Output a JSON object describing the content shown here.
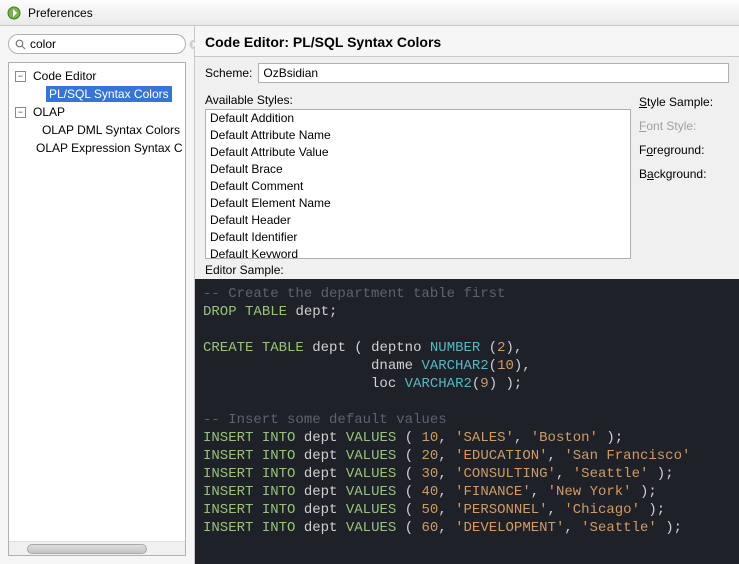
{
  "window": {
    "title": "Preferences"
  },
  "search": {
    "value": "color"
  },
  "tree": {
    "items": [
      {
        "label": "Code Editor"
      },
      {
        "label": "PL/SQL Syntax Colors"
      },
      {
        "label": "OLAP"
      },
      {
        "label": "OLAP DML Syntax Colors"
      },
      {
        "label": "OLAP Expression Syntax C"
      }
    ]
  },
  "panel": {
    "title": "Code Editor: PL/SQL Syntax Colors",
    "scheme_label": "Scheme:",
    "scheme_value": "OzBsidian",
    "available_styles_label": "Available Styles:",
    "styles": [
      "Default Addition",
      "Default Attribute Name",
      "Default Attribute Value",
      "Default Brace",
      "Default Comment",
      "Default Element Name",
      "Default Header",
      "Default Identifier",
      "Default Keyword"
    ],
    "style_sample_label": "Style Sample:",
    "font_style_label": "Font Style:",
    "foreground_label": "Foreground:",
    "background_label": "Background:",
    "editor_sample_label": "Editor Sample:"
  },
  "code": {
    "line1_comment": "-- Create the department table first",
    "drop": "DROP",
    "table": "TABLE",
    "dept": "dept",
    "semi": ";",
    "create": "CREATE",
    "lpar": "(",
    "rpar": ")",
    "deptno": "deptno",
    "number": "NUMBER",
    "num2": "2",
    "dname": "dname",
    "varchar2": "VARCHAR2",
    "num10": "10",
    "loc": "loc",
    "num9": "9",
    "comment2": "-- Insert some default values",
    "insert": "INSERT",
    "into": "INTO",
    "values": "VALUES",
    "rows": [
      {
        "n": "10",
        "a": "'SALES'",
        "b": "'Boston'"
      },
      {
        "n": "20",
        "a": "'EDUCATION'",
        "b": "'San Francisco'"
      },
      {
        "n": "30",
        "a": "'CONSULTING'",
        "b": "'Seattle'"
      },
      {
        "n": "40",
        "a": "'FINANCE'",
        "b": "'New York'"
      },
      {
        "n": "50",
        "a": "'PERSONNEL'",
        "b": "'Chicago'"
      },
      {
        "n": "60",
        "a": "'DEVELOPMENT'",
        "b": "'Seattle'"
      }
    ]
  }
}
